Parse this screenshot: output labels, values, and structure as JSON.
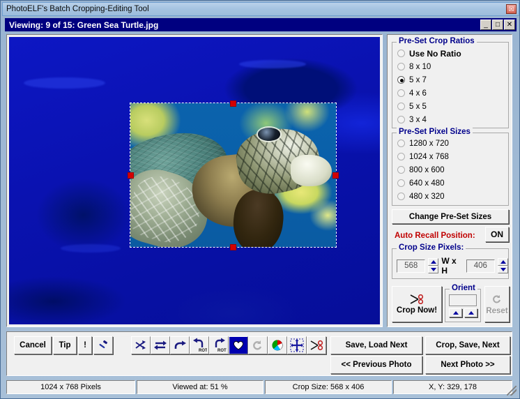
{
  "window": {
    "outer_title": "PhotoELF's Batch Cropping-Editing Tool",
    "outer_close_glyph": "☒",
    "inner_title": "Viewing:  9 of 15: Green Sea Turtle.jpg",
    "minimize_glyph": "_",
    "maximize_glyph": "□",
    "close_glyph": "✕"
  },
  "crop_ratios": {
    "legend": "Pre-Set Crop Ratios",
    "options": [
      {
        "label": "Use No Ratio",
        "selected": false,
        "bold": true
      },
      {
        "label": "8 x 10",
        "selected": false,
        "bold": false
      },
      {
        "label": "5 x 7",
        "selected": true,
        "bold": false
      },
      {
        "label": "4 x 6",
        "selected": false,
        "bold": false
      },
      {
        "label": "5 x 5",
        "selected": false,
        "bold": false
      },
      {
        "label": "3 x 4",
        "selected": false,
        "bold": false
      }
    ]
  },
  "pixel_sizes": {
    "legend": "Pre-Set Pixel Sizes",
    "options": [
      {
        "label": "1280 x 720",
        "selected": false
      },
      {
        "label": "1024 x 768",
        "selected": false
      },
      {
        "label": "800 x 600",
        "selected": false
      },
      {
        "label": "640 x 480",
        "selected": false
      },
      {
        "label": "480 x 320",
        "selected": false
      }
    ],
    "change_button": "Change Pre-Set Sizes"
  },
  "auto_recall": {
    "label": "Auto Recall Position:",
    "value": "ON"
  },
  "crop_size": {
    "legend": "Crop Size Pixels:",
    "width": "568",
    "height": "406",
    "separator": "W x H"
  },
  "actions": {
    "crop_now": "Crop Now!",
    "orient_legend": "Orient",
    "orient_value": "",
    "reset": "Reset"
  },
  "toolbar": {
    "cancel": "Cancel",
    "tip": "Tip",
    "bang": "!",
    "icons": [
      {
        "name": "hammer-icon"
      },
      {
        "name": "shuffle-icon"
      },
      {
        "name": "swap-horizontal-icon"
      },
      {
        "name": "flip-icon"
      },
      {
        "name": "rotate-left-icon",
        "sub": "ROT"
      },
      {
        "name": "rotate-right-icon",
        "sub": "ROT"
      },
      {
        "name": "favorite-heart-icon"
      },
      {
        "name": "undo-icon"
      },
      {
        "name": "color-wheel-icon"
      },
      {
        "name": "move-resize-icon"
      },
      {
        "name": "scissors-icon"
      }
    ],
    "save_load_next": "Save, Load Next",
    "crop_save_next": "Crop, Save, Next",
    "previous_photo": "<< Previous Photo",
    "next_photo": "Next Photo >>"
  },
  "status": {
    "dimensions": "1024 x 768 Pixels",
    "zoom": "Viewed at: 51 %",
    "crop_size": "Crop Size: 568 x 406",
    "coords": "X, Y: 329, 178"
  },
  "colors": {
    "title_blue": "#000080",
    "legend_blue": "#00008b",
    "alert_red": "#c00000",
    "handle_red": "#d40000"
  }
}
